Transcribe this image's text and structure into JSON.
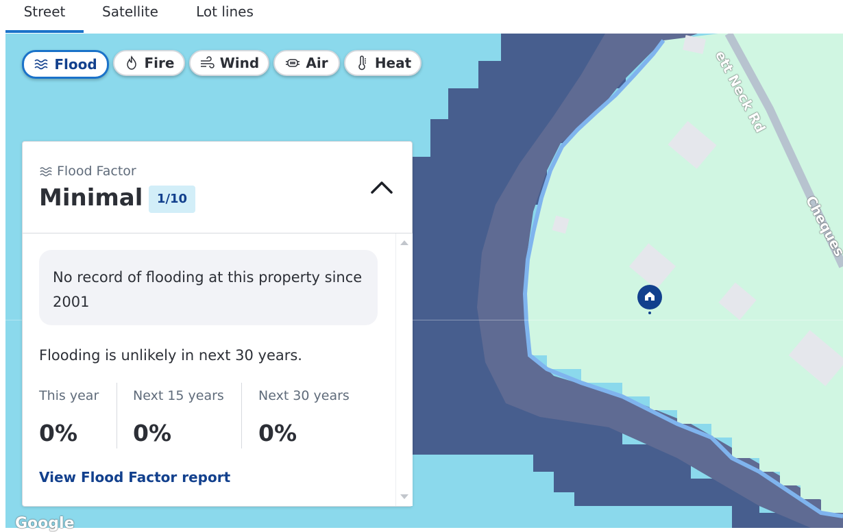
{
  "tabs": [
    {
      "label": "Street",
      "active": true
    },
    {
      "label": "Satellite",
      "active": false
    },
    {
      "label": "Lot lines",
      "active": false
    }
  ],
  "risk_chips": [
    {
      "label": "Flood",
      "icon": "waves-icon",
      "active": true
    },
    {
      "label": "Fire",
      "icon": "flame-icon",
      "active": false
    },
    {
      "label": "Wind",
      "icon": "wind-icon",
      "active": false
    },
    {
      "label": "Air",
      "icon": "mask-icon",
      "active": false
    },
    {
      "label": "Heat",
      "icon": "thermometer-icon",
      "active": false
    }
  ],
  "card": {
    "label": "Flood Factor",
    "title": "Minimal",
    "badge": "1/10",
    "notice": "No record of flooding at this property since 2001",
    "summary": "Flooding is unlikely in next 30 years.",
    "stats": [
      {
        "label": "This year",
        "value": "0%"
      },
      {
        "label": "Next 15 years",
        "value": "0%"
      },
      {
        "label": "Next 30 years",
        "value": "0%"
      }
    ],
    "link": "View Flood Factor report"
  },
  "map": {
    "road_labels": [
      "ett Neck Rd",
      "Cheques"
    ],
    "attribution": "Google",
    "colors": {
      "water_light": "#8bd9ec",
      "water_deep": "#475e8e",
      "flood_band": "#5d6a90",
      "land": "#d0f6e2",
      "building": "#e5e7ec",
      "pin": "#12408d",
      "accent": "#1a72c9"
    }
  }
}
